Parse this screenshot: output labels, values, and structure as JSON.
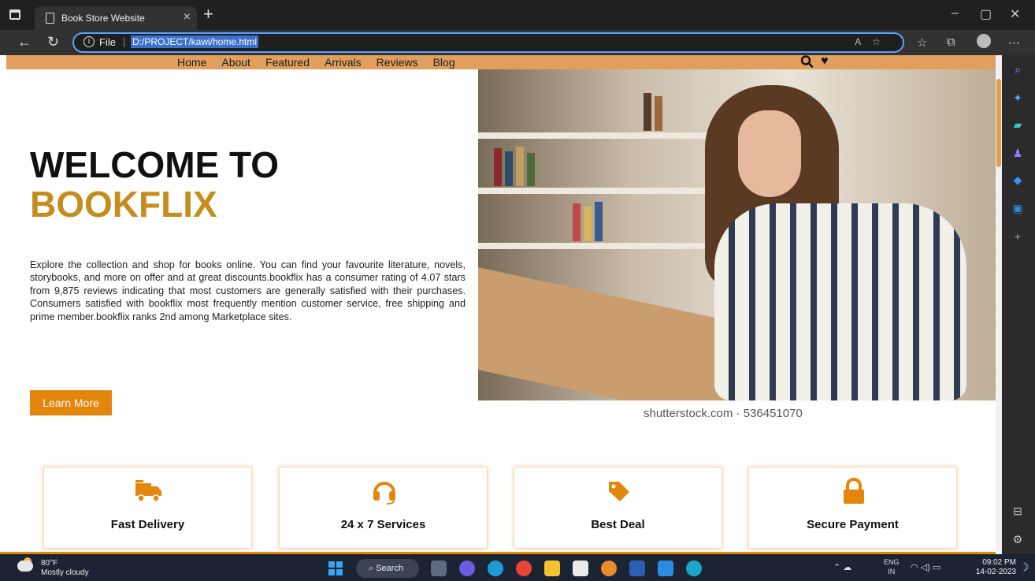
{
  "browser": {
    "tab_title": "Book Store Website",
    "tab_close": "×",
    "new_tab": "+",
    "address_scheme": "File",
    "address_path": "D:/PROJECT/kawi/home.html",
    "window_controls": [
      "–",
      "▢",
      "✕"
    ]
  },
  "navbar": {
    "links": [
      "Home",
      "About",
      "Featured",
      "Arrivals",
      "Reviews",
      "Blog"
    ],
    "search_icon": "search-icon",
    "heart_icon": "heart-icon"
  },
  "hero": {
    "title_line1": "WELCOME TO",
    "title_line2": "BOOKFLIX",
    "description": "Explore the collection and shop for books online. You can find your favourite literature, novels, storybooks, and more on offer and at great discounts.bookflix has a consumer rating of 4.07 stars from 9,875 reviews indicating that most customers are generally satisfied with their purchases. Consumers satisfied with bookflix most frequently mention customer service, free shipping and prime member.bookflix ranks 2nd among Marketplace sites.",
    "button_label": "Learn More",
    "image_watermark": "shutterstock.com · 536451070",
    "accent_color": "#c58d1e",
    "button_color": "#e4860c"
  },
  "features": [
    {
      "label": "Fast Delivery",
      "icon": "truck-icon"
    },
    {
      "label": "24 x 7 Services",
      "icon": "headset-icon"
    },
    {
      "label": "Best Deal",
      "icon": "tag-icon"
    },
    {
      "label": "Secure Payment",
      "icon": "lock-icon"
    }
  ],
  "taskbar": {
    "weather_temp": "80°F",
    "weather_desc": "Mostly cloudy",
    "search_label": "Search",
    "lang_line1": "ENG",
    "lang_line2": "IN",
    "time": "09:02 PM",
    "date": "14-02-2023"
  }
}
